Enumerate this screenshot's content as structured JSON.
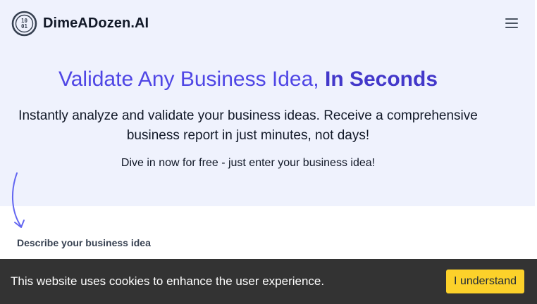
{
  "header": {
    "brand_name": "DimeADozen.AI",
    "logo_icon": "coin-binary-icon",
    "menu_icon": "hamburger-menu-icon"
  },
  "hero": {
    "title_main": "Validate Any Business Idea, ",
    "title_emphasis": "In Seconds",
    "subtitle": "Instantly analyze and validate your business ideas. Receive a comprehensive business report in just minutes, not days!",
    "cta_text": "Dive in now for free - just enter your business idea!"
  },
  "form": {
    "idea_label": "Describe your business idea"
  },
  "cookie_banner": {
    "message": "This website uses cookies to enhance the user experience.",
    "accept_label": "I understand"
  },
  "colors": {
    "hero_background": "#eff2fd",
    "accent": "#4f46e5",
    "cookie_bar": "#333333",
    "cookie_button": "#fcd12a"
  }
}
